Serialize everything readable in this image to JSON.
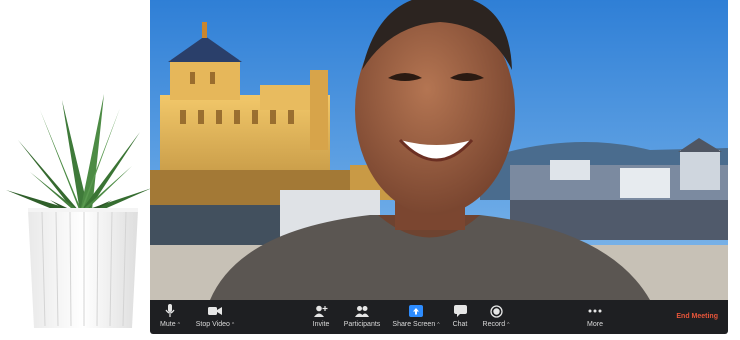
{
  "toolbar": {
    "mute": "Mute",
    "stop_video": "Stop Video",
    "invite": "Invite",
    "participants": "Participants",
    "share_screen": "Share Screen",
    "chat": "Chat",
    "record": "Record",
    "more": "More",
    "end_meeting": "End Meeting"
  },
  "colors": {
    "toolbar_bg": "#1e1f22",
    "share_accent": "#2d8cff",
    "end_meeting": "#e8553a"
  },
  "icons": [
    "mic-icon",
    "camera-icon",
    "add-person-icon",
    "participants-icon",
    "share-screen-icon",
    "chat-bubble-icon",
    "record-icon",
    "more-dots-icon"
  ]
}
